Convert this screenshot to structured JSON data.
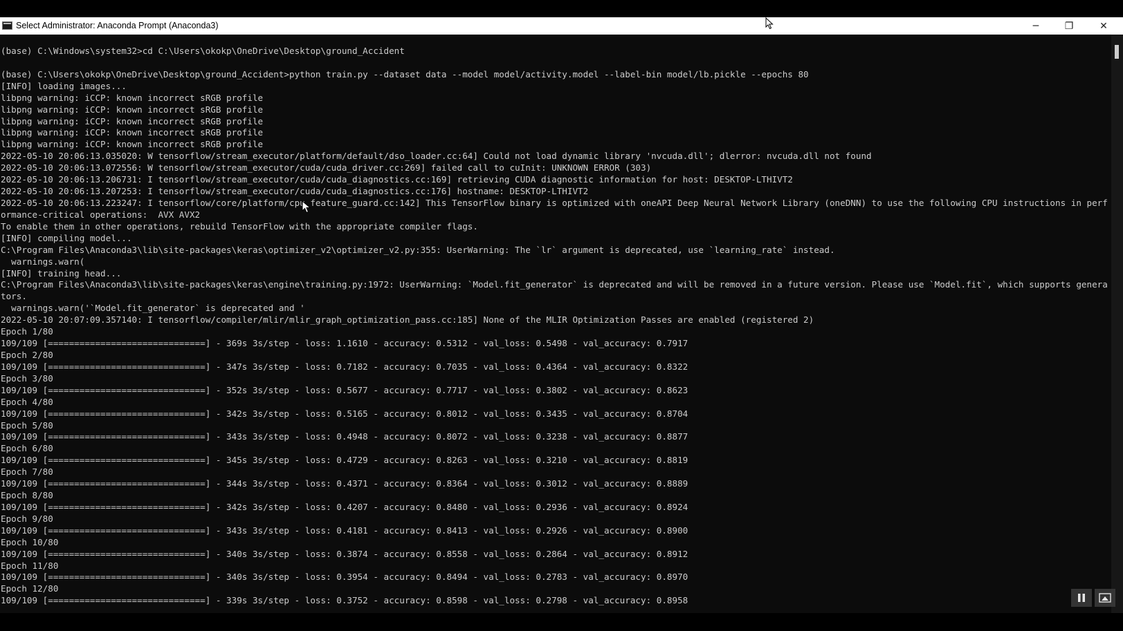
{
  "window": {
    "title": "Select Administrator: Anaconda Prompt (Anaconda3)",
    "controls": {
      "minimize": "─",
      "maximize": "❐",
      "close": "✕"
    }
  },
  "console": {
    "text_color": "#cccccc",
    "background": "#0c0c0c",
    "lines": [
      "(base) C:\\Windows\\system32>cd C:\\Users\\okokp\\OneDrive\\Desktop\\ground_Accident",
      "",
      "(base) C:\\Users\\okokp\\OneDrive\\Desktop\\ground_Accident>python train.py --dataset data --model model/activity.model --label-bin model/lb.pickle --epochs 80",
      "[INFO] loading images...",
      "libpng warning: iCCP: known incorrect sRGB profile",
      "libpng warning: iCCP: known incorrect sRGB profile",
      "libpng warning: iCCP: known incorrect sRGB profile",
      "libpng warning: iCCP: known incorrect sRGB profile",
      "libpng warning: iCCP: known incorrect sRGB profile",
      "2022-05-10 20:06:13.035020: W tensorflow/stream_executor/platform/default/dso_loader.cc:64] Could not load dynamic library 'nvcuda.dll'; dlerror: nvcuda.dll not found",
      "2022-05-10 20:06:13.072556: W tensorflow/stream_executor/cuda/cuda_driver.cc:269] failed call to cuInit: UNKNOWN ERROR (303)",
      "2022-05-10 20:06:13.206731: I tensorflow/stream_executor/cuda/cuda_diagnostics.cc:169] retrieving CUDA diagnostic information for host: DESKTOP-LTHIVT2",
      "2022-05-10 20:06:13.207253: I tensorflow/stream_executor/cuda/cuda_diagnostics.cc:176] hostname: DESKTOP-LTHIVT2",
      "2022-05-10 20:06:13.223247: I tensorflow/core/platform/cpu_feature_guard.cc:142] This TensorFlow binary is optimized with oneAPI Deep Neural Network Library (oneDNN) to use the following CPU instructions in perf",
      "ormance-critical operations:  AVX AVX2",
      "To enable them in other operations, rebuild TensorFlow with the appropriate compiler flags.",
      "[INFO] compiling model...",
      "C:\\Program Files\\Anaconda3\\lib\\site-packages\\keras\\optimizer_v2\\optimizer_v2.py:355: UserWarning: The `lr` argument is deprecated, use `learning_rate` instead.",
      "  warnings.warn(",
      "[INFO] training head...",
      "C:\\Program Files\\Anaconda3\\lib\\site-packages\\keras\\engine\\training.py:1972: UserWarning: `Model.fit_generator` is deprecated and will be removed in a future version. Please use `Model.fit`, which supports genera",
      "tors.",
      "  warnings.warn('`Model.fit_generator` is deprecated and '",
      "2022-05-10 20:07:09.357140: I tensorflow/compiler/mlir/mlir_graph_optimization_pass.cc:185] None of the MLIR Optimization Passes are enabled (registered 2)",
      "Epoch 1/80",
      "109/109 [==============================] - 369s 3s/step - loss: 1.1610 - accuracy: 0.5312 - val_loss: 0.5498 - val_accuracy: 0.7917",
      "Epoch 2/80",
      "109/109 [==============================] - 347s 3s/step - loss: 0.7182 - accuracy: 0.7035 - val_loss: 0.4364 - val_accuracy: 0.8322",
      "Epoch 3/80",
      "109/109 [==============================] - 352s 3s/step - loss: 0.5677 - accuracy: 0.7717 - val_loss: 0.3802 - val_accuracy: 0.8623",
      "Epoch 4/80",
      "109/109 [==============================] - 342s 3s/step - loss: 0.5165 - accuracy: 0.8012 - val_loss: 0.3435 - val_accuracy: 0.8704",
      "Epoch 5/80",
      "109/109 [==============================] - 343s 3s/step - loss: 0.4948 - accuracy: 0.8072 - val_loss: 0.3238 - val_accuracy: 0.8877",
      "Epoch 6/80",
      "109/109 [==============================] - 345s 3s/step - loss: 0.4729 - accuracy: 0.8263 - val_loss: 0.3210 - val_accuracy: 0.8819",
      "Epoch 7/80",
      "109/109 [==============================] - 344s 3s/step - loss: 0.4371 - accuracy: 0.8364 - val_loss: 0.3012 - val_accuracy: 0.8889",
      "Epoch 8/80",
      "109/109 [==============================] - 342s 3s/step - loss: 0.4207 - accuracy: 0.8480 - val_loss: 0.2936 - val_accuracy: 0.8924",
      "Epoch 9/80",
      "109/109 [==============================] - 343s 3s/step - loss: 0.4181 - accuracy: 0.8413 - val_loss: 0.2926 - val_accuracy: 0.8900",
      "Epoch 10/80",
      "109/109 [==============================] - 340s 3s/step - loss: 0.3874 - accuracy: 0.8558 - val_loss: 0.2864 - val_accuracy: 0.8912",
      "Epoch 11/80",
      "109/109 [==============================] - 340s 3s/step - loss: 0.3954 - accuracy: 0.8494 - val_loss: 0.2783 - val_accuracy: 0.8970",
      "Epoch 12/80",
      "109/109 [==============================] - 339s 3s/step - loss: 0.3752 - accuracy: 0.8598 - val_loss: 0.2798 - val_accuracy: 0.8958"
    ]
  },
  "icons": {
    "app": "console-icon",
    "cursor": "mouse-cursor-icon",
    "pause": "pause-icon",
    "screen": "screen-icon"
  }
}
